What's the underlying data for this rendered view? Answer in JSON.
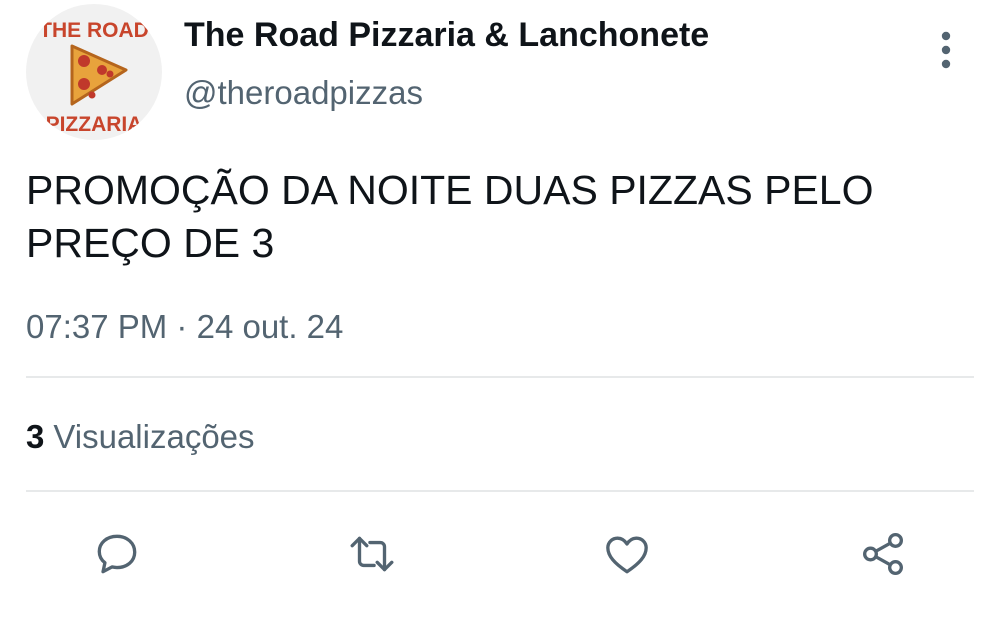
{
  "author": {
    "display_name": "The Road Pizzaria & Lanchonete",
    "handle": "@theroadpizzas",
    "avatar": {
      "top_text": "THE ROAD",
      "bottom_text": "PIZZARIA",
      "icon": "pizza-slice-icon"
    }
  },
  "tweet": {
    "text": "PROMOÇÃO DA NOITE DUAS PIZZAS PELO PREÇO DE 3",
    "time": "07:37 PM",
    "separator": "·",
    "date": "24 out. 24"
  },
  "stats": {
    "views_count": "3",
    "views_label": "Visualizações"
  },
  "actions": {
    "reply_icon": "speech-bubble-icon",
    "retweet_icon": "retweet-icon",
    "like_icon": "heart-icon",
    "share_icon": "share-icon",
    "more_icon": "vertical-dots-icon"
  },
  "colors": {
    "text_primary": "#0f1419",
    "text_secondary": "#536471",
    "divider": "#e7e9ea",
    "icon": "#536471",
    "avatar_text": "#c8452c"
  }
}
